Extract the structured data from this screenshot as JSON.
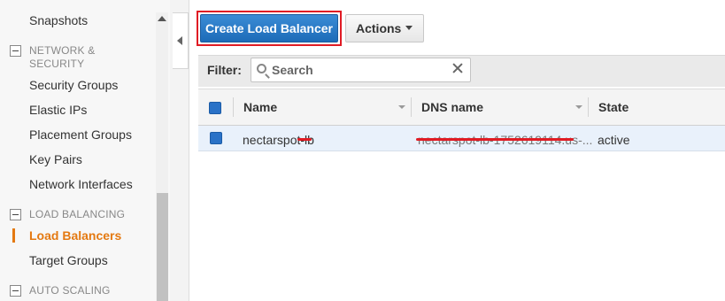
{
  "sidebar": {
    "items": [
      {
        "label": "Snapshots"
      },
      {
        "label": "Security Groups"
      },
      {
        "label": "Elastic IPs"
      },
      {
        "label": "Placement Groups"
      },
      {
        "label": "Key Pairs"
      },
      {
        "label": "Network Interfaces"
      },
      {
        "label": "Load Balancers",
        "active": true
      },
      {
        "label": "Target Groups"
      }
    ],
    "sections": [
      {
        "label": "NETWORK & SECURITY"
      },
      {
        "label": "LOAD BALANCING"
      },
      {
        "label": "AUTO SCALING"
      }
    ]
  },
  "toolbar": {
    "create_label": "Create Load Balancer",
    "actions_label": "Actions"
  },
  "filter": {
    "label": "Filter:",
    "placeholder": "Search"
  },
  "table": {
    "columns": [
      "Name",
      "DNS name",
      "State"
    ],
    "rows": [
      {
        "name": "nectarspot-lb",
        "dns": "nectarspot-lb-1752619114.us-...",
        "state": "active"
      }
    ]
  },
  "colors": {
    "accent": "#e47911",
    "primary": "#1d6bb8",
    "highlight": "#e01b24"
  }
}
